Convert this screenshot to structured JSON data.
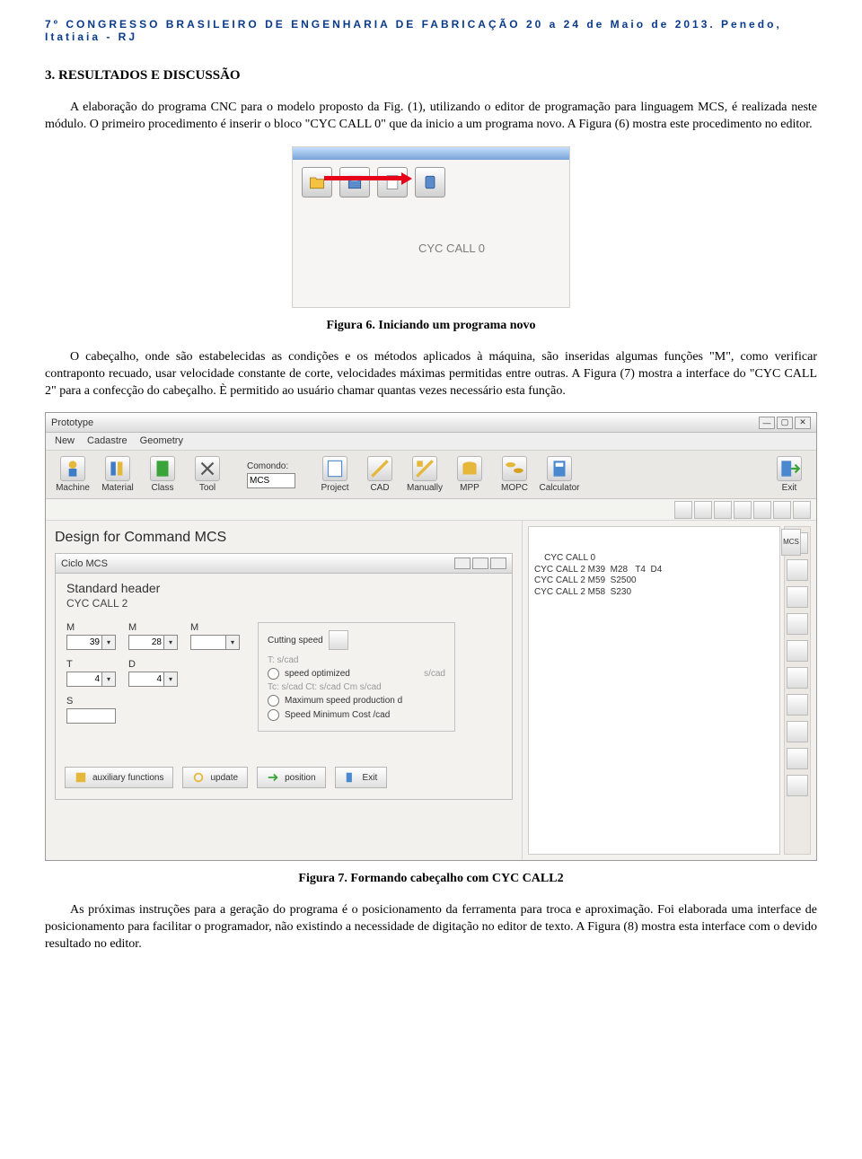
{
  "header": "7º CONGRESSO BRASILEIRO DE ENGENHARIA DE FABRICAÇÃO 20 a 24 de Maio de 2013. Penedo, Itatiaia - RJ",
  "section": "3.  RESULTADOS E DISCUSSÃO",
  "p1": "A elaboração do programa CNC para o modelo proposto da Fig. (1), utilizando o editor de programação para linguagem MCS, é realizada neste módulo. O primeiro procedimento é inserir o bloco \"CYC CALL 0\" que da inicio a um programa novo. A Figura (6) mostra este procedimento no editor.",
  "fig6": {
    "text": "CYC CALL 0",
    "caption": "Figura 6. Iniciando um programa novo"
  },
  "p2": "O cabeçalho, onde são estabelecidas as condições e os métodos aplicados à máquina, são inseridas algumas funções \"M\", como verificar contraponto recuado, usar velocidade constante de corte, velocidades máximas permitidas entre outras. A Figura (7) mostra a interface do \"CYC CALL 2\" para a confecção do cabeçalho. È permitido ao usuário chamar quantas vezes necessário esta função.",
  "fig7caption": "Figura 7. Formando cabeçalho com CYC CALL2",
  "p3": "As próximas instruções para a geração do programa é o posicionamento da ferramenta para troca e aproximação. Foi elaborada uma interface de posicionamento para facilitar o programador, não existindo a necessidade de digitação no editor de texto. A Figura (8) mostra esta interface com o devido resultado no editor.",
  "app": {
    "title": "Prototype",
    "menu": [
      "New",
      "Cadastre",
      "Geometry"
    ],
    "toolbar": [
      {
        "label": "Machine"
      },
      {
        "label": "Material"
      },
      {
        "label": "Class"
      },
      {
        "label": "Tool"
      }
    ],
    "comando": {
      "label": "Comondo:",
      "value": "MCS"
    },
    "toolbar2": [
      {
        "label": "Project"
      },
      {
        "label": "CAD"
      },
      {
        "label": "Manually"
      },
      {
        "label": "MPP"
      },
      {
        "label": "MOPC"
      },
      {
        "label": "Calculator"
      }
    ],
    "exit": "Exit",
    "design": "Design for Command  MCS",
    "codelabel": "MCS",
    "code": "CYC CALL 0\nCYC CALL 2 M39  M28   T4  D4\nCYC CALL 2 M59  S2500\nCYC CALL 2 M58  S230",
    "ciclo": {
      "title": "Ciclo MCS",
      "stdhead": "Standard header",
      "cyc": "CYC CALL 2",
      "m1": {
        "label": "M",
        "value": "39"
      },
      "m2": {
        "label": "M",
        "value": "28"
      },
      "m3": {
        "label": "M",
        "value": ""
      },
      "t": {
        "label": "T",
        "value": "4"
      },
      "d": {
        "label": "D",
        "value": "4"
      },
      "s": {
        "label": "S",
        "value": ""
      },
      "cut": {
        "title": "Cutting speed",
        "tscad": "T: s/cad",
        "opt1": "speed optimized",
        "scad": "s/cad",
        "tc": "Tc: s/cad   Ct: s/cad   Cm s/cad",
        "opt2": "Maximum speed production   d",
        "opt3": "Speed Minimum Cost    /cad"
      },
      "foot": [
        "auxiliary functions",
        "update",
        "position",
        "Exit"
      ]
    }
  }
}
